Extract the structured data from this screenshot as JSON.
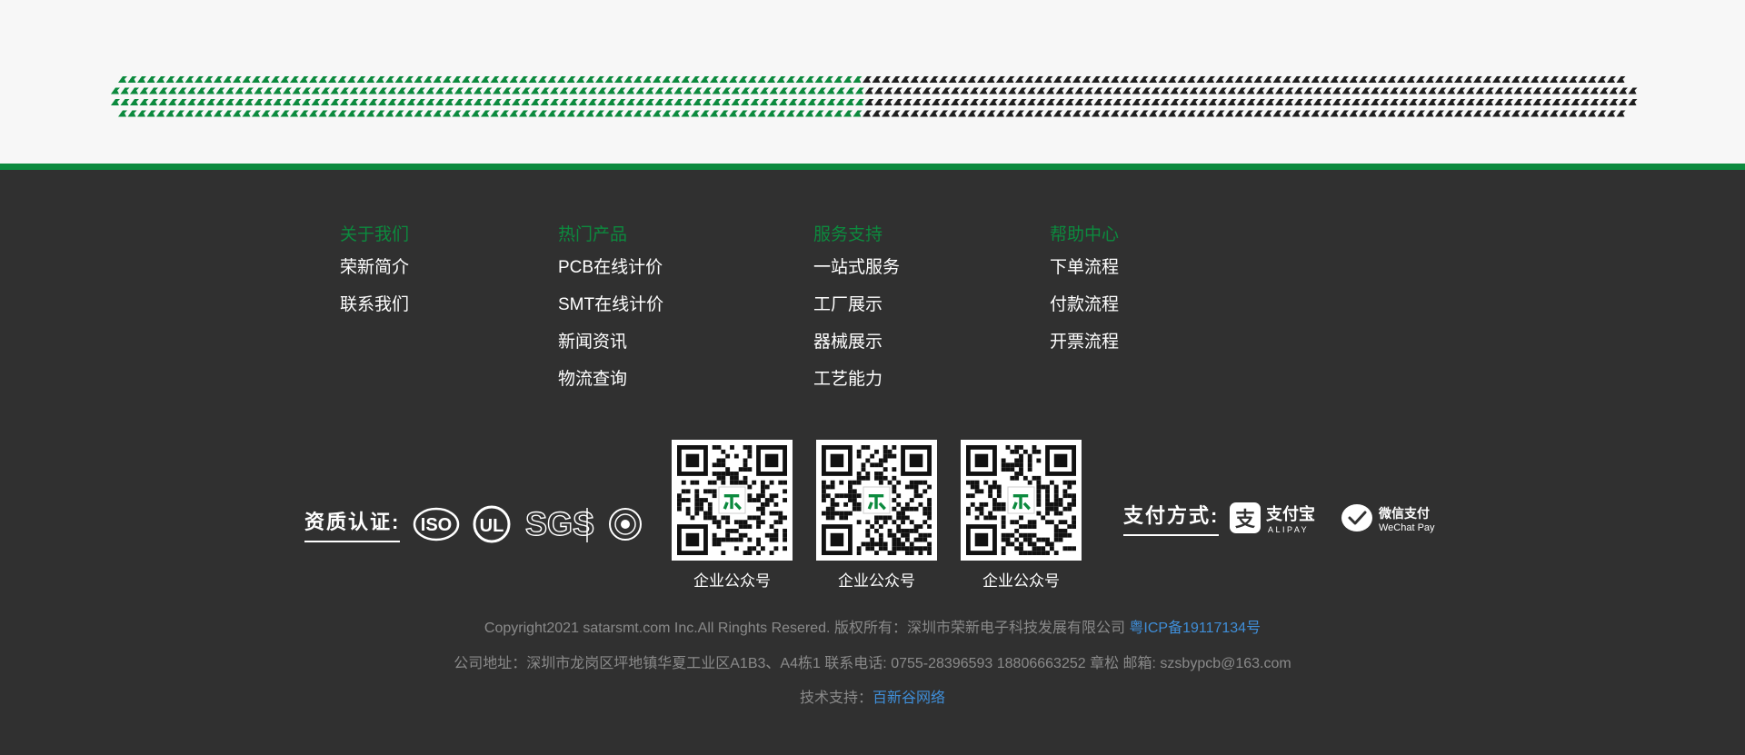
{
  "colors": {
    "accent_green": "#0c8a3e",
    "footer_bg": "#303030",
    "link_blue": "#3f8ed8",
    "muted_text": "#8a8a8a"
  },
  "columns": [
    {
      "title": "关于我们",
      "links": [
        "荣新简介",
        "联系我们"
      ]
    },
    {
      "title": "热门产品",
      "links": [
        "PCB在线计价",
        "SMT在线计价",
        "新闻资讯",
        "物流查询"
      ]
    },
    {
      "title": "服务支持",
      "links": [
        "一站式服务",
        "工厂展示",
        "器械展示",
        "工艺能力"
      ]
    },
    {
      "title": "帮助中心",
      "links": [
        "下单流程",
        "付款流程",
        "开票流程"
      ]
    }
  ],
  "certification": {
    "label": "资质认证:",
    "logos": [
      {
        "icon": "iso-logo-icon",
        "text": "ISO"
      },
      {
        "icon": "ul-logo-icon",
        "text": "UL"
      },
      {
        "icon": "sgs-logo-icon",
        "text": "SGS"
      },
      {
        "icon": "seal-logo-icon"
      }
    ]
  },
  "qr_codes": [
    {
      "label": "企业公众号"
    },
    {
      "label": "企业公众号"
    },
    {
      "label": "企业公众号"
    }
  ],
  "payment": {
    "label": "支付方式:",
    "alipay": {
      "icon": "alipay-icon",
      "name": "支付宝",
      "sub": "ALIPAY"
    },
    "wechat": {
      "icon": "wechat-pay-icon",
      "name": "微信支付",
      "sub": "WeChat Pay"
    }
  },
  "copyright": {
    "line1_text": "Copyright2021 satarsmt.com Inc.All Ringhts Resered. 版权所有：深圳市荣新电子科技发展有限公司",
    "icp_link": "粤ICP备19117134号",
    "line2_text": "公司地址：深圳市龙岗区坪地镇华夏工业区A1B3、A4栋1 联系电话: 0755-28396593 18806663252 章松 邮箱: szsbypcb@163.com",
    "tech_prefix": "技术支持：",
    "tech_link": "百新谷网络"
  }
}
